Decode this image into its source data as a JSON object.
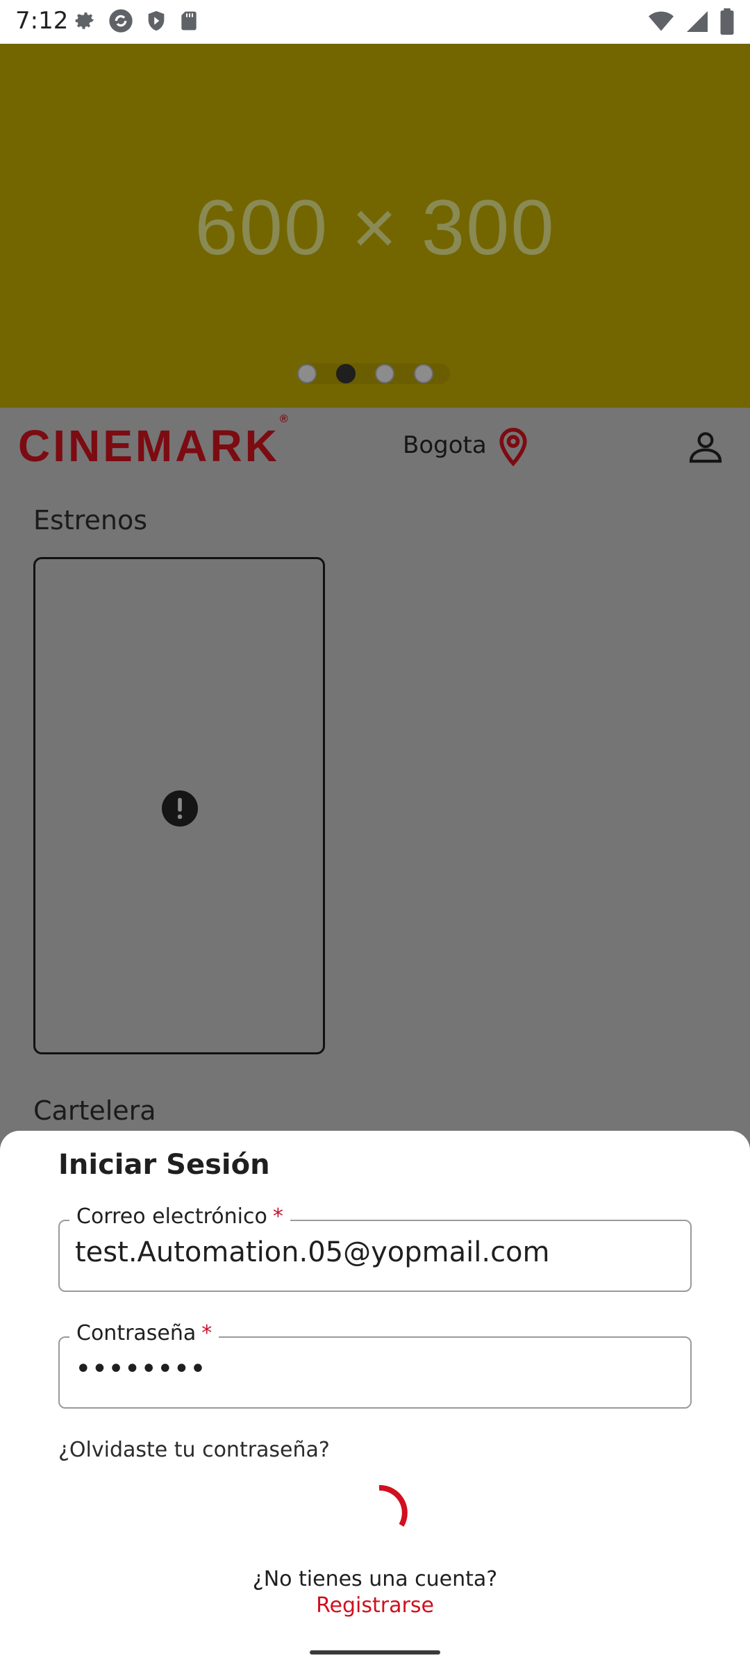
{
  "status_bar": {
    "time": "7:12",
    "left_icons": [
      "settings-icon",
      "sync-icon",
      "shield-icon",
      "sd-card-icon"
    ],
    "right_icons": [
      "wifi-icon",
      "signal-icon",
      "battery-icon"
    ]
  },
  "banner": {
    "placeholder_text": "600 × 300",
    "background_color": "#736600",
    "carousel": {
      "count": 4,
      "active_index": 1
    }
  },
  "header": {
    "logo": "CINEMARK",
    "logo_mark": "®",
    "city": "Bogota",
    "brand_color": "#7c0b12"
  },
  "sections": {
    "estrenos": "Estrenos",
    "cartelera": "Cartelera"
  },
  "login": {
    "title": "Iniciar Sesión",
    "email": {
      "label": "Correo electrónico",
      "required_mark": "*",
      "value": "test.Automation.05@yopmail.com"
    },
    "password": {
      "label": "Contraseña",
      "required_mark": "*",
      "value": "••••••••"
    },
    "forgot_link": "¿Olvidaste tu contraseña?",
    "no_account_text": "¿No tienes una cuenta?",
    "register_link": "Registrarse",
    "accent_color": "#d0101e"
  }
}
